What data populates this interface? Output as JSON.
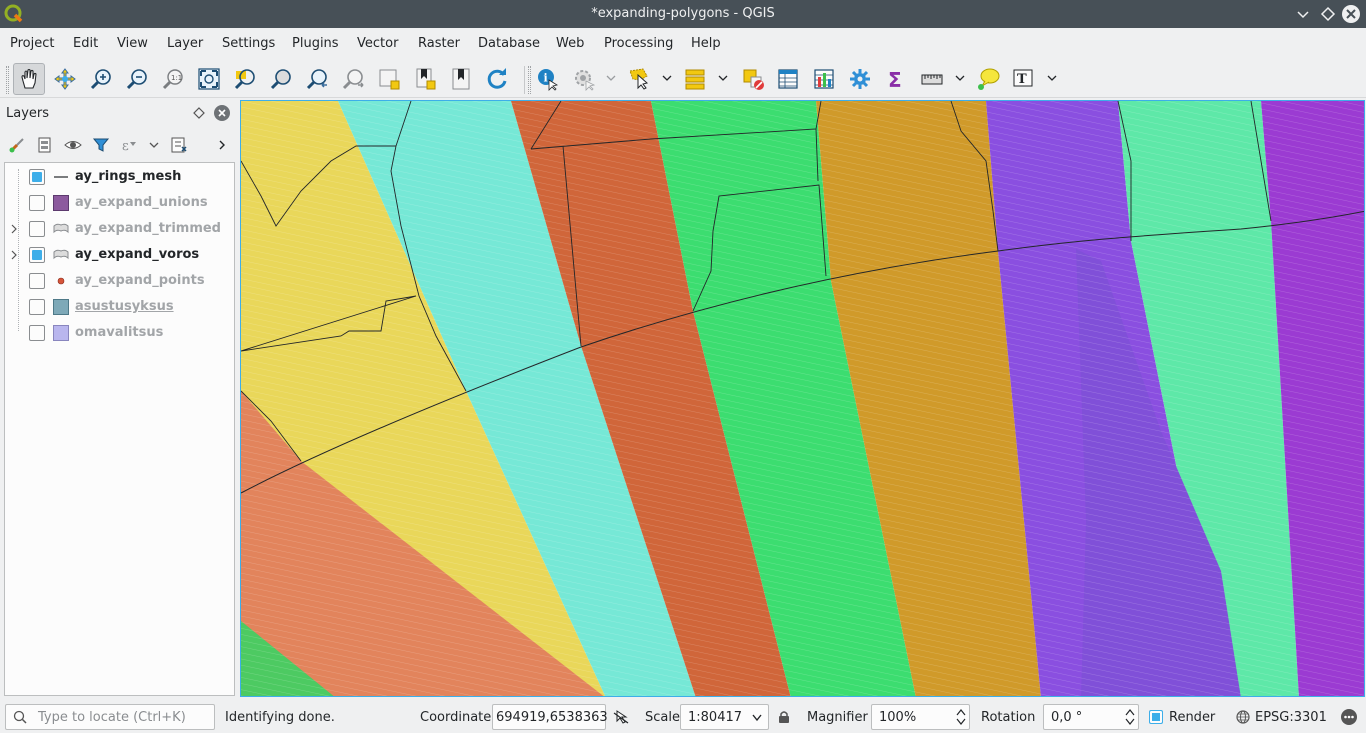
{
  "window": {
    "title": "*expanding-polygons - QGIS"
  },
  "menu": [
    "Project",
    "Edit",
    "View",
    "Layer",
    "Settings",
    "Plugins",
    "Vector",
    "Raster",
    "Database",
    "Web",
    "Processing",
    "Help"
  ],
  "layers_panel": {
    "title": "Layers",
    "layers": [
      {
        "name": "ay_rings_mesh",
        "checked": true,
        "style": "bold",
        "symbol": "line-icon"
      },
      {
        "name": "ay_expand_unions",
        "checked": false,
        "style": "dim",
        "symbol": "fill-swatch-icon",
        "color": "#8c5a9e"
      },
      {
        "name": "ay_expand_trimmed",
        "checked": false,
        "style": "dim",
        "symbol": "multi-polygon-icon",
        "expandable": true
      },
      {
        "name": "ay_expand_voros",
        "checked": true,
        "style": "bold",
        "symbol": "multi-polygon-icon",
        "expandable": true
      },
      {
        "name": "ay_expand_points",
        "checked": false,
        "style": "dim",
        "symbol": "point-icon",
        "color": "#d6553a"
      },
      {
        "name": "asustusyksus",
        "checked": false,
        "style": "dim",
        "symbol": "fill-swatch-icon",
        "color": "#7ea9b8",
        "underline": true
      },
      {
        "name": "omavalitsus",
        "checked": false,
        "style": "dim",
        "symbol": "fill-swatch-icon",
        "color": "#b9b6ee"
      }
    ]
  },
  "statusbar": {
    "locator_placeholder": "Type to locate (Ctrl+K)",
    "message": "Identifying done.",
    "coordinate_label": "Coordinate",
    "coordinate_value": "694919,6538363",
    "scale_label": "Scale",
    "scale_value": "1:80417",
    "magnifier_label": "Magnifier",
    "magnifier_value": "100%",
    "rotation_label": "Rotation",
    "rotation_value": "0,0 °",
    "render_label": "Render",
    "render_checked": true,
    "crs": "EPSG:3301"
  },
  "colors": {
    "accent": "#3daee9",
    "titlebar": "#475057",
    "polygon_colors": [
      "#e9d75a",
      "#76e8d6",
      "#d0663a",
      "#3cdd70",
      "#d09a2a",
      "#8a4fe0",
      "#5ee8a8",
      "#9b3bd2",
      "#e2845c",
      "#4dca62"
    ]
  }
}
